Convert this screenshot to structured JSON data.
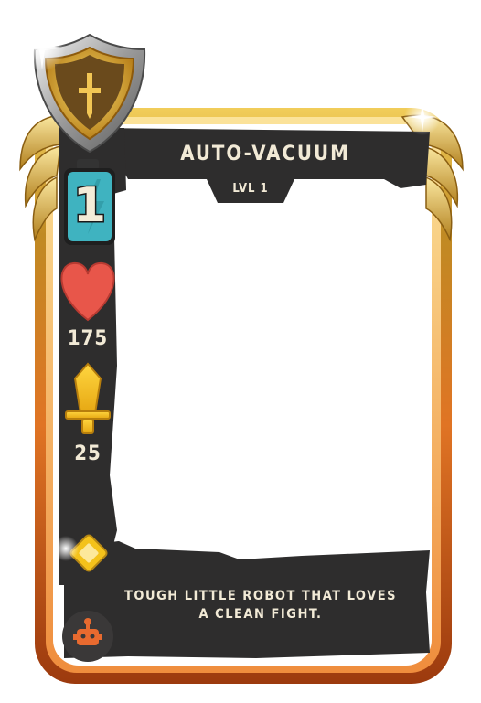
{
  "card": {
    "name": "AUTO-VACUUM",
    "level": "LVL 1",
    "mana_cost": "1",
    "health": "175",
    "attack": "25",
    "description_line1": "TOUGH LITTLE ROBOT THAT LOVES",
    "description_line2": "A CLEAN FIGHT."
  },
  "icons": {
    "rarity": "shield-emblem-icon",
    "mana": "battery-icon",
    "health": "heart-icon",
    "attack": "sword-icon",
    "edition": "gold-gem-icon",
    "type": "robot-icon"
  },
  "colors": {
    "frame_gold": "#c99a2a",
    "frame_orange": "#d9641c",
    "panel_dark": "#2e2d2d",
    "mana_teal": "#3fb3c0",
    "heart_red": "#e8564a",
    "sword_gold": "#f2c21a",
    "text_cream": "#f2ead6"
  }
}
